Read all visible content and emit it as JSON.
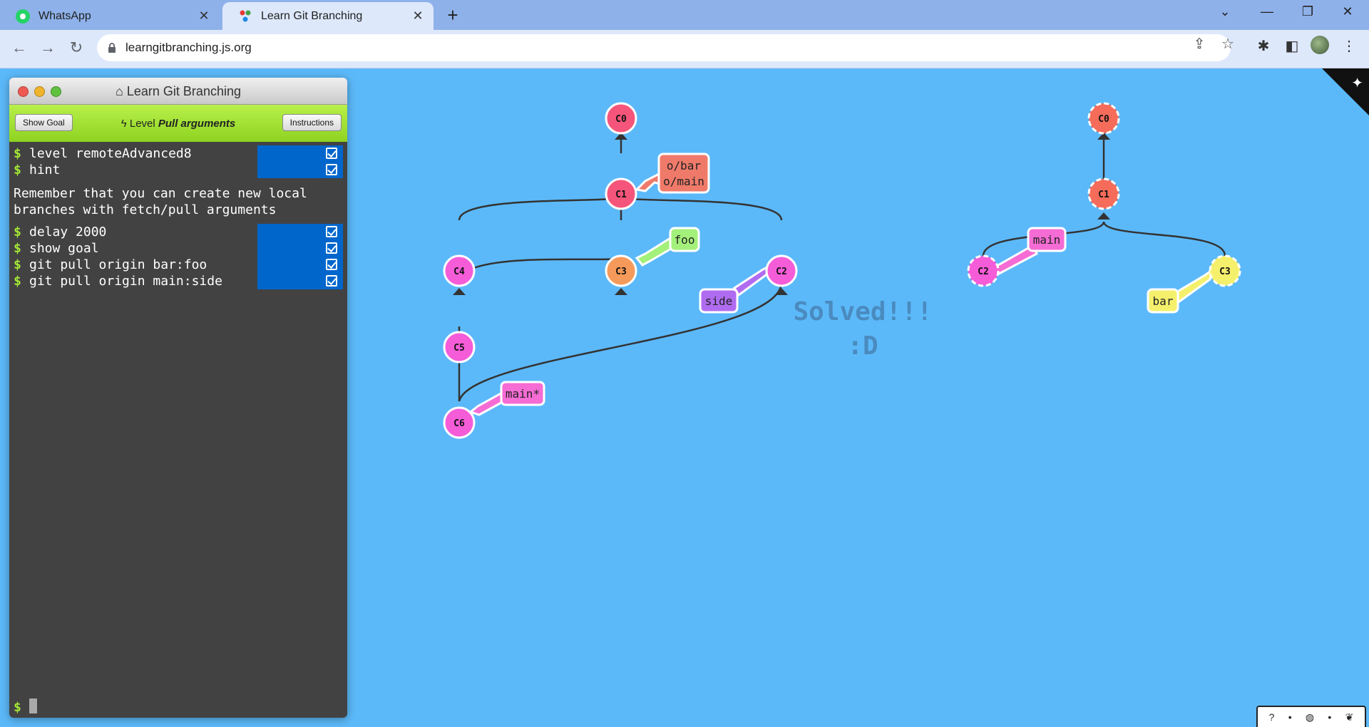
{
  "browser": {
    "tabs": [
      {
        "label": "WhatsApp",
        "icon": "whatsapp-icon"
      },
      {
        "label": "Learn Git Branching",
        "icon": "git-icon",
        "active": true
      }
    ],
    "url": "learngitbranching.js.org"
  },
  "terminal": {
    "title": "Learn Git Branching",
    "show_goal": "Show Goal",
    "instructions": "Instructions",
    "level_prefix": "Level",
    "level_name": "Pull arguments",
    "commands": [
      "level remoteAdvanced8",
      "hint"
    ],
    "hint_text": "Remember that you can create new local branches with fetch/pull arguments",
    "commands2": [
      "delay 2000",
      "show goal",
      "git pull origin bar:foo",
      "git pull origin main:side"
    ],
    "prompt": "$"
  },
  "solved": {
    "line1": "Solved!!!",
    "line2": ":D"
  },
  "graph": {
    "commits": [
      "C0",
      "C1",
      "C3",
      "C4",
      "C2",
      "C5",
      "C6"
    ],
    "branches": [
      "o/bar",
      "o/main",
      "foo",
      "side",
      "main*"
    ],
    "remote_commits": [
      "C0",
      "C1",
      "C2",
      "C3"
    ],
    "remote_branches": [
      "main",
      "bar"
    ]
  },
  "colors": {
    "background": "#5cb9f9",
    "terminal": "#424242",
    "accent_green": "#a3e635",
    "status_blue": "#0066cc"
  }
}
